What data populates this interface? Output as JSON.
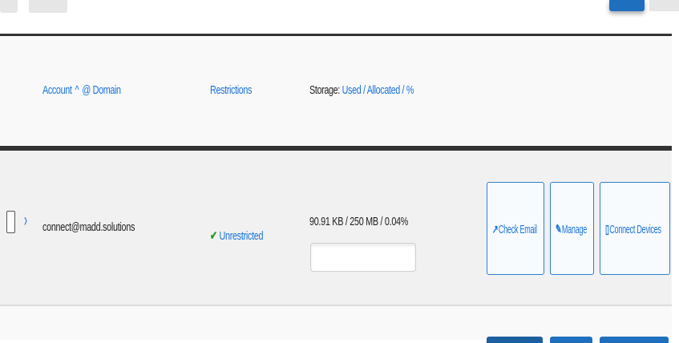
{
  "table": {
    "header": {
      "account_label": "Account",
      "sort_glyph": "^",
      "domain_label": "@ Domain",
      "restrictions_label": "Restrictions",
      "storage_prefix": "Storage:",
      "storage_used": "Used",
      "storage_sep1": " / ",
      "storage_allocated": "Allocated",
      "storage_sep2": " / ",
      "storage_percent": "%"
    },
    "rows": [
      {
        "expand_glyph": "›",
        "account": "connect@madd.solutions",
        "restriction_icon": "✔",
        "restriction": "Unrestricted",
        "storage": "90.91 KB / 250 MB / 0.04%",
        "storage_fraction": 0.0004,
        "actions": {
          "check_email_icon": "↗",
          "check_email": "Check Email",
          "manage_icon": "✎",
          "manage": "Manage",
          "connect_devices_icon": "▯",
          "connect_devices": "Connect Devices"
        }
      }
    ]
  },
  "colors": {
    "link": "#1a73d9",
    "primary_button": "#1f6fbf",
    "success": "#2a9a2a"
  },
  "icons": {
    "row_checkbox": "checkbox-icon",
    "expand": "chevron-right-icon",
    "restriction": "check-icon",
    "check_email": "external-link-icon",
    "manage": "pencil-icon",
    "connect_devices": "device-icon"
  }
}
